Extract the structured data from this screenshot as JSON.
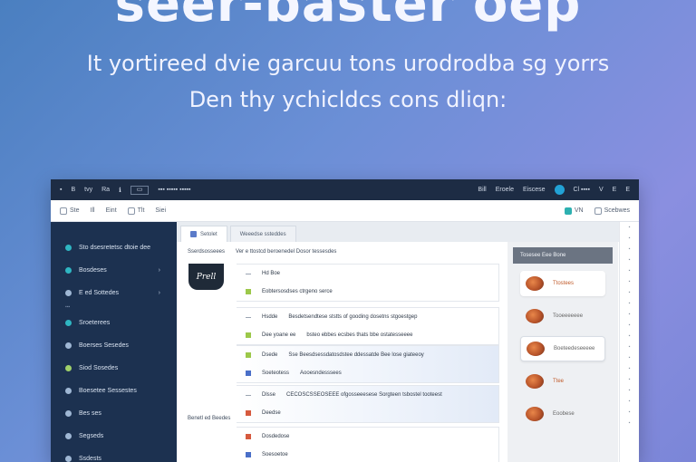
{
  "hero": {
    "title": "seer-baster oep",
    "subtitle_1": "It yortireed dvie garcuu tons urodrodba sg yorrs",
    "subtitle_2": "Den thy ychicldcs cons dliqn:"
  },
  "titlebar": {
    "items": [
      "▪",
      "B",
      "tvy",
      "Ra",
      "ℹ"
    ],
    "chip": "▭",
    "title": "▪▪▪ ▪▪▪▪▪ ▪▪▪▪▪",
    "right_items": [
      "Bill",
      "Eroele",
      "Eiscese"
    ],
    "user": "Cl ▪▪▪▪",
    "controls": [
      "V",
      "E",
      "E"
    ]
  },
  "toolbar": {
    "left": [
      "Ste",
      "Ill",
      "Eint",
      "Tlt",
      "Siei"
    ],
    "right_badge": "VN",
    "right_label": "Scebwes"
  },
  "sidebar": {
    "items": [
      {
        "label": "Sto dsesretetsc dtoie dee",
        "icon": "globe-icon"
      },
      {
        "label": "Bosdeses",
        "icon": "leaf-icon",
        "chevron": "›"
      },
      {
        "label": "E ed  Sottedes",
        "icon": "gear-icon",
        "chevron": "›"
      },
      {
        "label": "Sroeterees",
        "icon": "globe-icon"
      },
      {
        "label": "Boerses Sesedes",
        "icon": "pin-icon"
      },
      {
        "label": "Siod Sosedes",
        "icon": "bulb-icon"
      },
      {
        "label": "Boesetee Sessestes",
        "icon": "cloud-icon"
      },
      {
        "label": "Bes ses",
        "icon": "shield-icon"
      },
      {
        "label": "Segseds",
        "icon": "globe-icon"
      },
      {
        "label": "Ssdests",
        "icon": "globe-icon"
      }
    ],
    "separator": "▪▪▪"
  },
  "tabs": [
    {
      "label": "Setolet",
      "active": true
    },
    {
      "label": "Weeedse ssteddes",
      "active": false
    }
  ],
  "crumb": [
    "Sserdsosseees",
    "Ver e ttostcd beroenedel Dosor tessesdes"
  ],
  "logo": "Prell",
  "cards": [
    {
      "rows": [
        {
          "marker": "none",
          "label": "Hd  Boe",
          "text": ""
        },
        {
          "marker": "green",
          "label": "Eobtersosdses ctrgeno serce",
          "text": ""
        }
      ]
    },
    {
      "rows": [
        {
          "marker": "none",
          "label": "Hsdde",
          "text": "Besdetsendtese ststts of gooding dosetns stgoestgep"
        },
        {
          "marker": "green",
          "label": "Dee yoane ee",
          "text": "bsteo ebbes ecsbes thats bbe ostatesseeee"
        }
      ]
    },
    {
      "rows": [
        {
          "marker": "green",
          "label": "Dsede",
          "text": "Sse Beesdsessdatosdstee ddessatde Bee lose giateeoy"
        },
        {
          "marker": "blue",
          "label": "Soeteotess",
          "text": "Aooesndesssees"
        }
      ]
    },
    {
      "rows": [
        {
          "marker": "none",
          "label": "Dlsse",
          "text": "CECOSCSSEOSEEE ofgosseeesese Sorgteen tsbostel tooteest"
        },
        {
          "marker": "red",
          "label": "Deedse",
          "text": ""
        }
      ]
    },
    {
      "rows": [
        {
          "marker": "red",
          "label": "Dosdedose",
          "text": ""
        },
        {
          "marker": "blue",
          "label": "Soesoetoe",
          "text": ""
        }
      ]
    }
  ],
  "left_note": "Benetl ed Beedes",
  "panel": {
    "header": "Tosesee Eee Bone",
    "items": [
      {
        "label": "Ttostees",
        "style": "card"
      },
      {
        "label": "Tooeeeeeee",
        "style": "plain"
      },
      {
        "label": "Boeteedeseeeee",
        "style": "boxed"
      },
      {
        "label": "Ttee",
        "style": "plain"
      },
      {
        "label": "Eoobese",
        "style": "plain"
      }
    ]
  },
  "scroll_ticks": [
    "▪",
    "▪",
    "▪",
    "▪",
    "▪",
    "▪",
    "▪",
    "▪",
    "▪",
    "▪",
    "▪",
    "▪",
    "▪",
    "▪",
    "▪",
    "▪",
    "▪",
    "▪",
    "▪"
  ]
}
